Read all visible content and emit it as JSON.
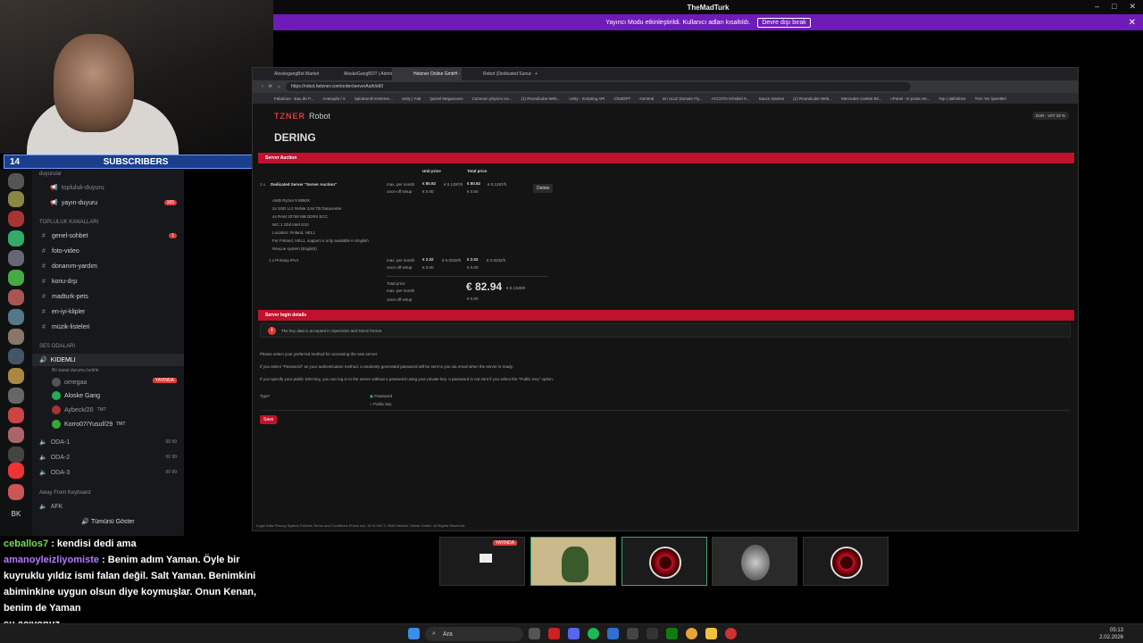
{
  "window": {
    "title": "TheMadTurk"
  },
  "banner": {
    "text": "Yayıncı Modu etkinleştirildi. Kullanıcı adları kısaltıldı.",
    "button": "Devre dışı bırak"
  },
  "subscribers": {
    "left": "14",
    "label": "SUBSCRIBERS",
    "right": "10"
  },
  "sidebar": {
    "cat1": "duyurular",
    "ch_topluluk": "topluluk-duyuru",
    "ch_yayin": "yayın-duyuru",
    "yayin_badge": "165",
    "cat2": "TOPLULUK KANALLARI",
    "channels": [
      {
        "label": "genel-sohbet",
        "badge": "1"
      },
      {
        "label": "foto-video"
      },
      {
        "label": "donanım-yardım"
      },
      {
        "label": "konu-dışı"
      },
      {
        "label": "madturk-pets"
      },
      {
        "label": "en-iyi-klipler"
      },
      {
        "label": "müzik-listeleri"
      }
    ],
    "cat3": "SES ODALARI",
    "voice_main": "KIDEMLI",
    "voice_sub": "Bir kanal durumu belirle",
    "members": [
      {
        "name": "omegaa"
      },
      {
        "name": "Aloske Gang",
        "live": "YAYINDA"
      },
      {
        "name": "Aybeck/20",
        "tag": "TMT"
      },
      {
        "name": "Korro07/Yusuf/29",
        "tag": "TMT"
      }
    ],
    "voice_rooms": [
      "ODA-1",
      "ODA-2",
      "ODA-3"
    ],
    "room_counts": [
      "00",
      "99"
    ],
    "away_cat": "Away From Keyboard",
    "afk": "AFK",
    "show_all": "Tümünü Göster",
    "bk": "BK"
  },
  "chat": [
    {
      "user": "ceballos7",
      "msg": " : kendisi dedi ama"
    },
    {
      "user": "amanoyleizliyomiste",
      "msg": " : Benim adım Yaman. Öyle bir kuyruklu yıldız ismi falan değil. Salt Yaman. Benimkini abiminkine uygun olsun diye koymuşlar. Onun Kenan, benim de Yaman"
    },
    {
      "user": "",
      "msg": "su açıyonuz"
    }
  ],
  "browser": {
    "tabs": [
      "AloskegangBot Market",
      "AloskeGangBOT | Admin Panel",
      "Hetzner Online GmbH - Robot",
      "Robot (Dedicated Sunucu Kira"
    ],
    "url": "https://robot.hetzner.com/order/serverAuth/id/0",
    "bookmarks": [
      "Fabulous - Eau de P...",
      "Anasayfa / X",
      "Spiratomik Extreme...",
      "Unity | Fab",
      "Quixel Megascans",
      "Common physics iss...",
      "(1) Roundcube Web...",
      "Unity - Scripting API",
      "ChatGPT",
      "General",
      "En Ucuz Domain Fiy...",
      "ACCOTA Kılıskiel X...",
      "Sauce Games",
      "(1) Roundcube Web...",
      "Mercedes Ceeket Bil...",
      "cPanel - E-posta He...",
      "Top | dafinitizer",
      "Tüm Yer İşaretleri"
    ],
    "logo": "TZNER",
    "logo_sub": "Robot",
    "currency": "EUR · VAT 19 %",
    "heading": "DERING",
    "section1": "Server Auction",
    "col_unit": "Unit price",
    "col_total": "Total price",
    "qty": "1 x",
    "server_name": "Dedicated Server \"Server Auction\"",
    "specs": [
      "AMD Ryzen 9 5950X",
      "2x SSD U.2 NVMe 3,84 TB Datacenter",
      "4x RAM 32768 MB DDR4 ECC",
      "NIC 1 Gbit Intel I210",
      "Location: Finland, HEL1",
      "For Finland, HEL1, support is only available in English",
      "Rescue system (English)"
    ],
    "row1_label1": "max. per month",
    "row1_unit": "€ 80.92",
    "row1_unit_h": "€ 0.1297/h",
    "row1_total": "€ 80.92",
    "row1_total_h": "€ 0.1297/h",
    "row1_label2": "once-off setup",
    "row1_setup": "€ 0.00",
    "delete": "Delete",
    "ipv4": "1 x Primary IPv4",
    "row2_unit": "€ 2.02",
    "row2_unit_h": "€ 0.0032/h",
    "row2_total": "€ 2.02",
    "row2_total_h": "€ 0.0032/h",
    "total_label": "Total price",
    "total_max": "max. per month",
    "total_value": "€ 82.94",
    "total_h": "€ 0.1329/h",
    "total_setup": "€ 0.00",
    "section2": "Server login details",
    "info_text": "The key data is accepted in OpenSSH and SSH2 format.",
    "para1": "Please select your preferred method for accessing the new server:",
    "para2": "If you select \"Password\" as your authentication method, a randomly generated password will be sent to you via email when the server is ready.",
    "para3": "If you specify your public SSH key, you can log in to the server without a password using your private key. A password is not sent if you select the \"Public Key\" option.",
    "type_label": "Type*",
    "opt1": "Password",
    "opt2": "Public key",
    "save": "Save",
    "footer": "Legal   Data Privacy   System Policies   Terms and Conditions   Prices incl. 19 % VAT   © 2026 Hetzner Online GmbH. All Rights Reserved."
  },
  "thumbs": {
    "live": "YAYINDA"
  },
  "taskbar": {
    "search": "Ara",
    "time": "05:13",
    "date": "2.02.2026"
  }
}
